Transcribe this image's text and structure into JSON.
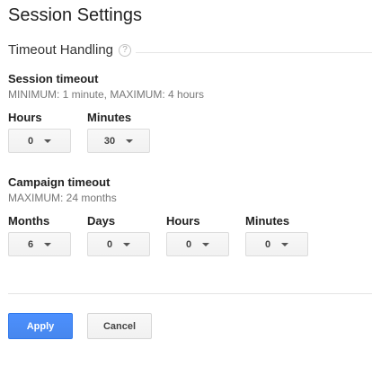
{
  "page": {
    "title": "Session Settings"
  },
  "timeout_section": {
    "heading": "Timeout Handling",
    "help_glyph": "?"
  },
  "session_timeout": {
    "label": "Session timeout",
    "hint": "MINIMUM: 1 minute, MAXIMUM: 4 hours",
    "hours_label": "Hours",
    "hours_value": "0",
    "minutes_label": "Minutes",
    "minutes_value": "30"
  },
  "campaign_timeout": {
    "label": "Campaign timeout",
    "hint": "MAXIMUM: 24 months",
    "months_label": "Months",
    "months_value": "6",
    "days_label": "Days",
    "days_value": "0",
    "hours_label": "Hours",
    "hours_value": "0",
    "minutes_label": "Minutes",
    "minutes_value": "0"
  },
  "actions": {
    "apply_label": "Apply",
    "cancel_label": "Cancel"
  },
  "colors": {
    "primary": "#4d90fe",
    "primary_border": "#3079ed"
  }
}
